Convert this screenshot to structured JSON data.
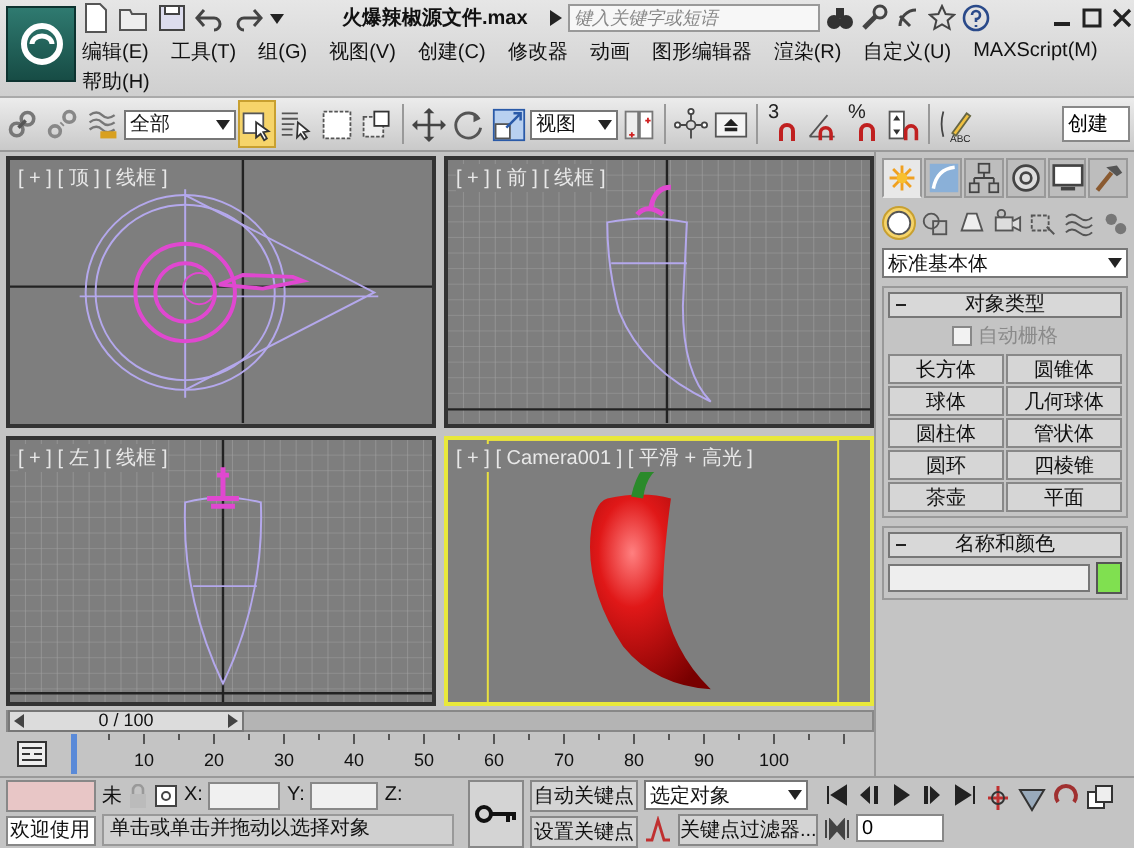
{
  "window": {
    "title": "火爆辣椒源文件.max",
    "search": {
      "placeholder": "键入关键字或短语"
    }
  },
  "menu": [
    [
      "编辑(E)",
      "工具(T)",
      "组(G)",
      "视图(V)",
      "创建(C)",
      "修改器",
      "动画",
      "图形编辑器",
      "渲染(R)",
      "自定义(U)",
      "MAXScript(M)"
    ],
    [
      "帮助(H)"
    ]
  ],
  "main_toolbar": [
    {
      "kind": "link",
      "selected": false
    },
    {
      "kind": "unlink",
      "selected": false
    },
    {
      "kind": "bind",
      "selected": false
    },
    {
      "kind": "dropdown",
      "value": "全部"
    },
    {
      "kind": "select-object",
      "selected": true
    },
    {
      "kind": "select-by-name",
      "selected": false
    },
    {
      "kind": "rect-region",
      "selected": false
    },
    {
      "kind": "window-crossing",
      "selected": false
    },
    {
      "kind": "move",
      "selected": false
    },
    {
      "kind": "rotate",
      "selected": false
    },
    {
      "kind": "scale",
      "selected": false
    },
    {
      "kind": "dropdown",
      "value": "视图"
    },
    {
      "kind": "pivot",
      "selected": false
    },
    {
      "kind": "manipulate",
      "selected": false
    },
    {
      "kind": "keyboard",
      "selected": false
    },
    {
      "kind": "snap",
      "label": "3",
      "selected": false
    },
    {
      "kind": "angle-snap",
      "selected": false
    },
    {
      "kind": "percent-snap",
      "label": "%",
      "selected": false
    },
    {
      "kind": "spinner-snap",
      "selected": false
    },
    {
      "kind": "edit-named",
      "label": "ABC",
      "selected": false
    },
    {
      "kind": "field",
      "value": "创建"
    }
  ],
  "viewports": [
    {
      "kind": "top",
      "label": "[ + ] [ 顶 ] [ 线框 ]",
      "active": false
    },
    {
      "kind": "front",
      "label": "[ + ] [ 前 ] [ 线框 ]",
      "active": false
    },
    {
      "kind": "left",
      "label": "[ + ] [ 左 ] [ 线框 ]",
      "active": false
    },
    {
      "kind": "camera",
      "label": "[ + ] [ Camera001 ] [ 平滑 + 高光 ]",
      "active": true
    }
  ],
  "command_panel": {
    "tabs": [
      {
        "kind": "create",
        "selected": true
      },
      {
        "kind": "modify",
        "selected": false
      },
      {
        "kind": "hierarchy",
        "selected": false
      },
      {
        "kind": "motion",
        "selected": false
      },
      {
        "kind": "display",
        "selected": false
      },
      {
        "kind": "utilities",
        "selected": false
      }
    ],
    "categories": [
      {
        "kind": "geometry",
        "selected": true
      },
      {
        "kind": "shapes",
        "selected": false
      },
      {
        "kind": "lights",
        "selected": false
      },
      {
        "kind": "cameras",
        "selected": false
      },
      {
        "kind": "helpers",
        "selected": false
      },
      {
        "kind": "spacewarps",
        "selected": false
      },
      {
        "kind": "systems",
        "selected": false
      }
    ],
    "object_class": "标准基本体",
    "object_type": {
      "title": "对象类型",
      "expanded": true,
      "autogrid": {
        "label": "自动栅格",
        "checked": false,
        "disabled": true
      },
      "buttons": [
        "长方体",
        "圆锥体",
        "球体",
        "几何球体",
        "圆柱体",
        "管状体",
        "圆环",
        "四棱锥",
        "茶壶",
        "平面"
      ]
    },
    "name_color": {
      "title": "名称和颜色",
      "expanded": true
    }
  },
  "time_slider": {
    "label": "0 / 100",
    "level": 0
  },
  "track_bar": {
    "ticks": [
      "10",
      "20",
      "30",
      "40",
      "50",
      "60",
      "70",
      "80",
      "90",
      "100"
    ]
  },
  "status": {
    "welcome": "欢迎使用",
    "selection": "未",
    "coords": [
      "X:",
      "Y:",
      "Z:"
    ],
    "prompt": "单击或单击并拖动以选择对象",
    "auto_key": {
      "label": "自动关键点",
      "on": false
    },
    "set_key": "设置关键点",
    "key_mode": "选定对象",
    "key_filters": "关键点过滤器...",
    "frame": "0"
  }
}
